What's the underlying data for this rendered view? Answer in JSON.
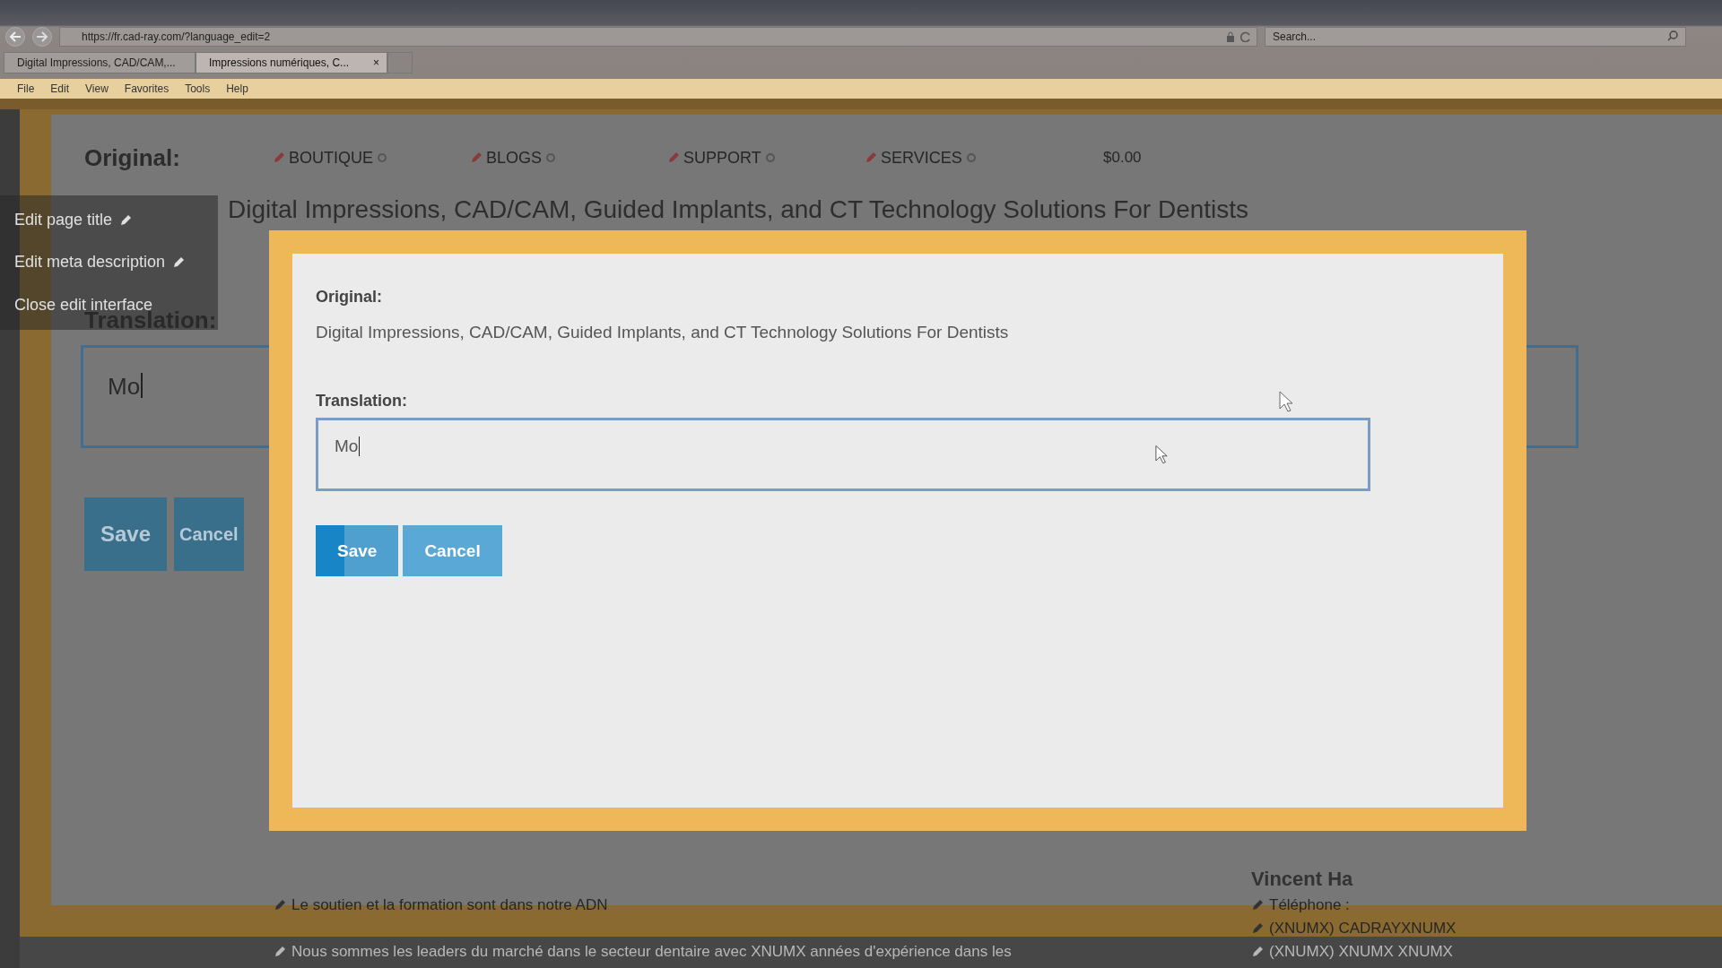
{
  "browser": {
    "address": "https://fr.cad-ray.com/?language_edit=2",
    "search": {
      "placeholder": "Search..."
    },
    "tabs": [
      {
        "label": "Digital Impressions, CAD/CAM,...",
        "selected": false
      },
      {
        "label": "Impressions numériques, C...",
        "selected": true,
        "close": "×"
      }
    ],
    "menu": [
      "File",
      "Edit",
      "View",
      "Favorites",
      "Tools",
      "Help"
    ]
  },
  "page": {
    "original_label": "Original:",
    "nav": [
      "BOUTIQUE",
      "BLOGS",
      "SUPPORT",
      "SERVICES"
    ],
    "cart_total": "$0.00",
    "original_text": "Digital Impressions, CAD/CAM, Guided Implants, and CT Technology Solutions For Dentists",
    "translation_label": "Translation:",
    "translation_value": "Mo",
    "buttons": [
      "Save",
      "Cancel"
    ],
    "footer_left": [
      "Le soutien et la formation sont dans notre ADN",
      "Nous sommes les leaders du marché dans le secteur dentaire avec XNUMX années d'expérience dans les"
    ],
    "footer_right": [
      {
        "kind": "name",
        "text": "Vincent Ha"
      },
      {
        "kind": "line",
        "text": "Téléphone :"
      },
      {
        "kind": "line",
        "text": "(XNUMX) CADRAYXNUMX"
      },
      {
        "kind": "line",
        "text": "(XNUMX) XNUMX XNUMX"
      }
    ]
  },
  "edit_menu": [
    {
      "label": "Edit page title",
      "pencil": true
    },
    {
      "label": "Edit meta description",
      "pencil": true
    },
    {
      "label": "Close edit interface",
      "pencil": false
    }
  ],
  "dialog": {
    "original_label": "Original:",
    "original_text": "Digital Impressions, CAD/CAM, Guided Implants, and CT Technology Solutions For Dentists",
    "translation_label": "Translation:",
    "translation_value": "Mo",
    "buttons": [
      "Save",
      "Cancel"
    ]
  }
}
